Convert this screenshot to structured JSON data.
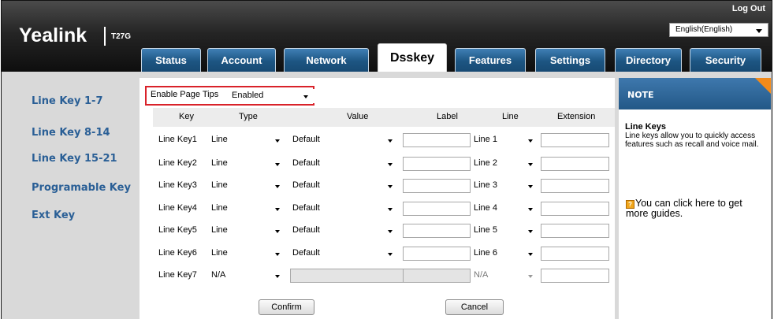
{
  "header": {
    "brand": "Yealink",
    "model": "T27G",
    "logout": "Log Out",
    "language": "English(English)"
  },
  "tabs": [
    {
      "label": "Status"
    },
    {
      "label": "Account"
    },
    {
      "label": "Network"
    },
    {
      "label": "Dsskey",
      "active": true
    },
    {
      "label": "Features"
    },
    {
      "label": "Settings"
    },
    {
      "label": "Directory"
    },
    {
      "label": "Security"
    }
  ],
  "sidebar": {
    "items": [
      {
        "label": "Line Key 1-7",
        "active": true
      },
      {
        "label": "Line Key 8-14"
      },
      {
        "label": "Line Key 15-21"
      },
      {
        "label": "Programable Key"
      },
      {
        "label": "Ext Key"
      }
    ]
  },
  "page_tips": {
    "label": "Enable Page Tips",
    "value": "Enabled"
  },
  "table": {
    "headers": [
      "Key",
      "Type",
      "Value",
      "Label",
      "Line",
      "Extension"
    ],
    "rows": [
      {
        "key": "Line Key1",
        "type": "Line",
        "value": "Default",
        "label": "",
        "line": "Line 1",
        "extension": ""
      },
      {
        "key": "Line Key2",
        "type": "Line",
        "value": "Default",
        "label": "",
        "line": "Line 2",
        "extension": ""
      },
      {
        "key": "Line Key3",
        "type": "Line",
        "value": "Default",
        "label": "",
        "line": "Line 3",
        "extension": ""
      },
      {
        "key": "Line Key4",
        "type": "Line",
        "value": "Default",
        "label": "",
        "line": "Line 4",
        "extension": ""
      },
      {
        "key": "Line Key5",
        "type": "Line",
        "value": "Default",
        "label": "",
        "line": "Line 5",
        "extension": ""
      },
      {
        "key": "Line Key6",
        "type": "Line",
        "value": "Default",
        "label": "",
        "line": "Line 6",
        "extension": ""
      },
      {
        "key": "Line Key7",
        "type": "N/A",
        "value": "",
        "label": "",
        "line": "N/A",
        "extension": ""
      }
    ]
  },
  "buttons": {
    "confirm": "Confirm",
    "cancel": "Cancel"
  },
  "note": {
    "heading": "NOTE",
    "title": "Line Keys",
    "description": "Line keys allow you to quickly access features such as recall and voice mail.",
    "guide_icon": "?",
    "guide": "You can click here to get more guides."
  },
  "colors": {
    "tab_blue": "#1d5582",
    "link_blue": "#2a5f96",
    "highlight_red": "#d9222a",
    "note_orange": "#f28a1a"
  }
}
